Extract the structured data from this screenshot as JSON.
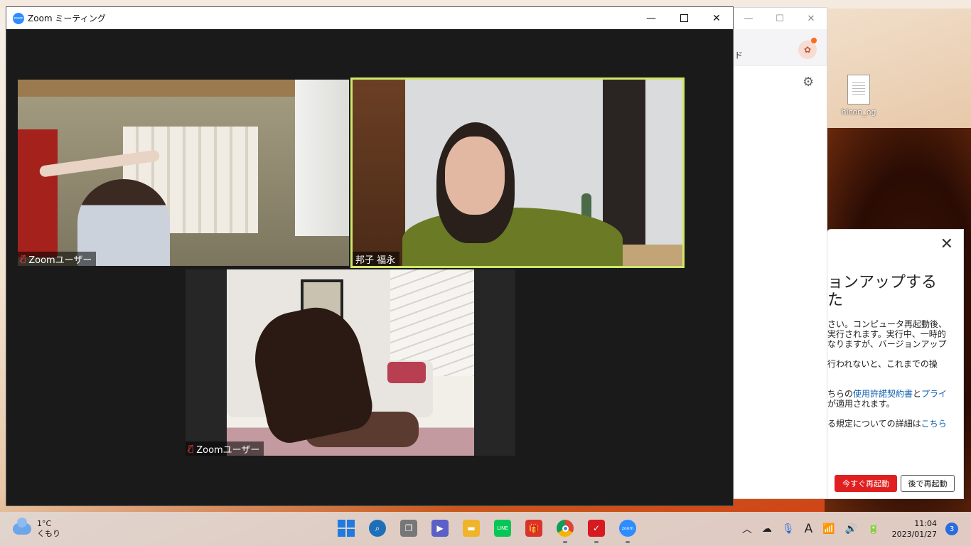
{
  "meeting_window": {
    "title": "Zoom ミーティング",
    "app_icon_text": "zoom"
  },
  "participants": [
    {
      "name": "Zoomユーザー",
      "muted": true,
      "active_speaker": false
    },
    {
      "name": "邦子 福永",
      "muted": false,
      "active_speaker": true
    },
    {
      "name": "Zoomユーザー",
      "muted": true,
      "active_speaker": false
    }
  ],
  "background_window": {
    "header_text": "ド"
  },
  "desktop": {
    "file_name": "hicon_og"
  },
  "update_panel": {
    "title": "ョンアップする\nた",
    "body_line1": "さい。コンピュータ再起動後、\n実行されます。実行中、一時的\nなりますが、バージョンアップ",
    "body_line2": "行われないと、これまでの操",
    "body_line3_pre": "ちらの",
    "body_link1": "使用許諾契約書",
    "body_line3_mid": "と",
    "body_link2": "プライ",
    "body_line4": "が適用されます。",
    "body_line5_pre": "る規定についての詳細は",
    "body_link3": "こちら",
    "restart_now": "今すぐ再起動",
    "restart_later": "後で再起動"
  },
  "taskbar": {
    "weather_temp": "1°C",
    "weather_condition": "くもり",
    "apps": [
      {
        "name": "start",
        "color": "#1f7be0"
      },
      {
        "name": "search",
        "color": "#1d6fb8"
      },
      {
        "name": "task-view",
        "color": "#666666"
      },
      {
        "name": "teams-chat",
        "color": "#5b5fc7"
      },
      {
        "name": "file-explorer",
        "color": "#f0b429"
      },
      {
        "name": "line",
        "color": "#06c755"
      },
      {
        "name": "gift",
        "color": "#d9342b"
      },
      {
        "name": "chrome",
        "color": "#db4437"
      },
      {
        "name": "trend-micro",
        "color": "#d71920"
      },
      {
        "name": "zoom",
        "color": "#2d8cff"
      }
    ],
    "time": "11:04",
    "date": "2023/01/27",
    "notification_count": "3"
  }
}
